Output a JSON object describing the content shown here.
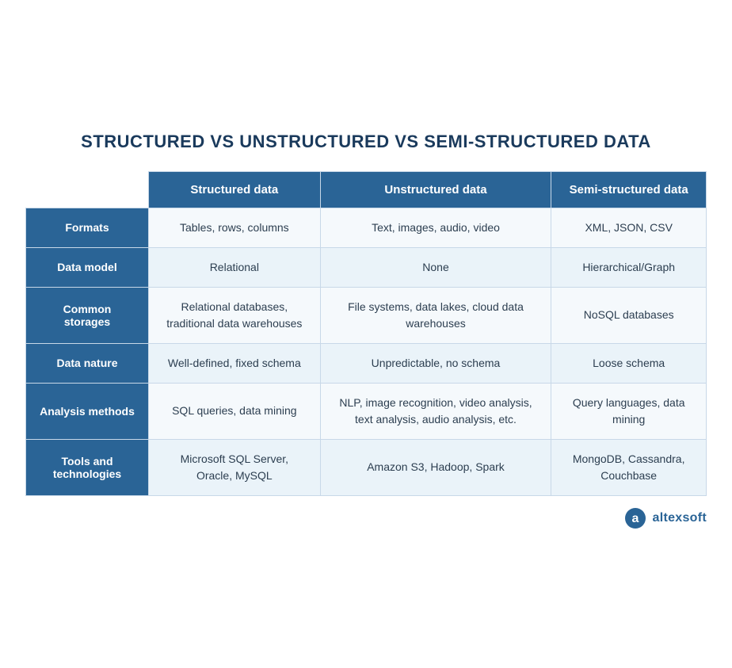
{
  "title": "STRUCTURED VS UNSTRUCTURED VS SEMI-STRUCTURED DATA",
  "columns": {
    "empty_header": "",
    "col1": "Structured data",
    "col2": "Unstructured data",
    "col3": "Semi-structured data"
  },
  "rows": [
    {
      "header": "Formats",
      "col1": "Tables, rows, columns",
      "col2": "Text, images, audio, video",
      "col3": "XML, JSON, CSV"
    },
    {
      "header": "Data model",
      "col1": "Relational",
      "col2": "None",
      "col3": "Hierarchical/Graph"
    },
    {
      "header": "Common storages",
      "col1": "Relational databases, traditional data warehouses",
      "col2": "File systems, data lakes, cloud data warehouses",
      "col3": "NoSQL databases"
    },
    {
      "header": "Data nature",
      "col1": "Well-defined, fixed schema",
      "col2": "Unpredictable, no schema",
      "col3": "Loose schema"
    },
    {
      "header": "Analysis methods",
      "col1": "SQL queries, data mining",
      "col2": "NLP, image recognition, video analysis, text analysis, audio analysis, etc.",
      "col3": "Query languages, data mining"
    },
    {
      "header": "Tools and technologies",
      "col1": "Microsoft SQL Server, Oracle, MySQL",
      "col2": "Amazon S3, Hadoop, Spark",
      "col3": "MongoDB, Cassandra, Couchbase"
    }
  ],
  "branding": {
    "name": "altexsoft"
  }
}
